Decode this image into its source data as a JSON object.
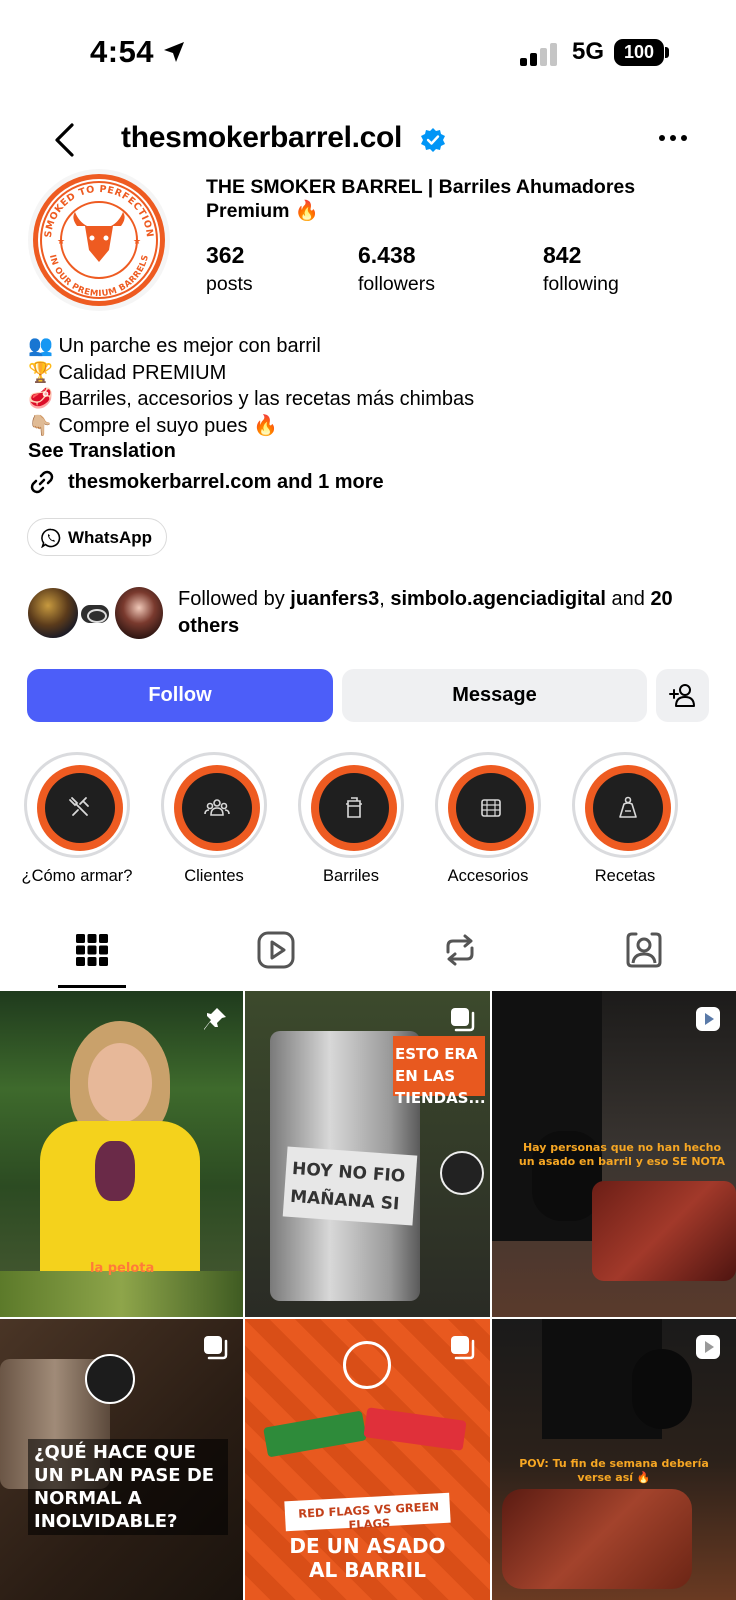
{
  "status_bar": {
    "time": "4:54",
    "network": "5G",
    "battery": "100"
  },
  "header": {
    "username": "thesmokerbarrel.col"
  },
  "profile": {
    "avatar_text_top": "SMOKED TO PERFECTION",
    "avatar_text_bottom": "IN OUR PREMIUM BARRELS",
    "display_name": "THE SMOKER BARREL | Barriles Ahumadores Premium 🔥",
    "stats": [
      {
        "value": "362",
        "label": "posts"
      },
      {
        "value": "6.438",
        "label": "followers"
      },
      {
        "value": "842",
        "label": "following"
      }
    ],
    "bio": [
      "👥 Un parche es mejor con barril",
      "🏆 Calidad PREMIUM",
      "🥩 Barriles, accesorios y las recetas más chimbas",
      "👇🏼 Compre el suyo pues 🔥"
    ],
    "see_translation": "See Translation",
    "link": "thesmokerbarrel.com and 1 more",
    "whatsapp_label": "WhatsApp"
  },
  "followed_by": {
    "prefix": "Followed by ",
    "user1": "juanfers3",
    "sep": ", ",
    "user2": "simbolo.agenciadigital",
    "and": " and ",
    "others": "20 others"
  },
  "actions": {
    "follow": "Follow",
    "message": "Message"
  },
  "highlights": [
    {
      "label": "¿Cómo armar?",
      "icon": "tools-icon"
    },
    {
      "label": "Clientes",
      "icon": "people-icon"
    },
    {
      "label": "Barriles",
      "icon": "barrel-icon"
    },
    {
      "label": "Accesorios",
      "icon": "grill-icon"
    },
    {
      "label": "Recetas",
      "icon": "chef-icon"
    }
  ],
  "tabs": [
    "grid-icon",
    "reels-icon",
    "reposts-icon",
    "tagged-icon"
  ],
  "posts": [
    {
      "text": "la pelota",
      "badge": "pin-icon"
    },
    {
      "text": "ESTO ERA EN LAS TIENDAS...",
      "subtext": "HOY NO FIO MAÑANA SI",
      "badge": "carousel-icon"
    },
    {
      "text": "Hay personas que no han hecho un asado en barril y eso SE NOTA",
      "badge": "reel-icon"
    },
    {
      "text": "¿QUÉ HACE QUE UN PLAN PASE DE NORMAL A INOLVIDABLE?",
      "badge": "carousel-icon"
    },
    {
      "text": "RED FLAGS VS GREEN FLAGS",
      "subtext": "DE UN ASADO AL BARRIL",
      "badge": "carousel-icon"
    },
    {
      "text": "POV: Tu fin de semana debería verse así 🔥",
      "badge": "reel-icon"
    }
  ],
  "colors": {
    "accent": "#4c5ef9",
    "brand_orange": "#ee5b21",
    "verified": "#0095f6"
  }
}
